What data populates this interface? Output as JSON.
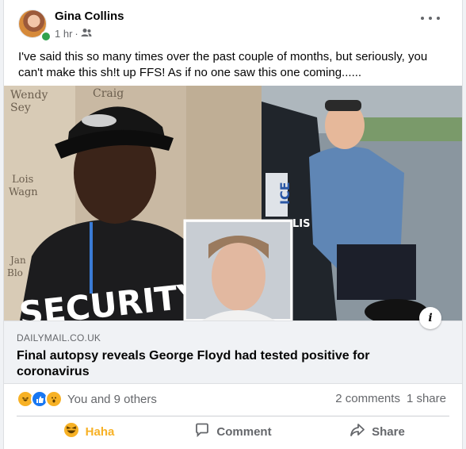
{
  "post": {
    "author": "Gina Collins",
    "time": "1 hr",
    "separator": "·",
    "text": "I've said this so many times over the past couple of months, but seriously, you can't make this sh!t up FFS! As if no one saw this one coming......"
  },
  "link": {
    "domain": "DAILYMAIL.CO.UK",
    "title": "Final autopsy reveals George Floyd had tested positive for coronavirus",
    "info": "i"
  },
  "photo": {
    "shirt_text": "SECURITY",
    "hat_text": "",
    "sign_texts": [
      "Wendy",
      "Sey",
      "Craig",
      "Lois",
      "Wagn",
      "Jan",
      "Blo"
    ],
    "car_texts": [
      "ICE",
      "LIS"
    ]
  },
  "engagement": {
    "reactions_text": "You and 9 others",
    "comments": "2 comments",
    "shares": "1 share",
    "reaction_icons": [
      "haha-icon",
      "like-icon",
      "wow-icon"
    ]
  },
  "actions": {
    "haha": "Haha",
    "comment": "Comment",
    "share": "Share"
  },
  "colors": {
    "haha_active": "#f7b125",
    "like_blue": "#1877f2",
    "online_green": "#31a24c",
    "secondary_text": "#65676b"
  }
}
